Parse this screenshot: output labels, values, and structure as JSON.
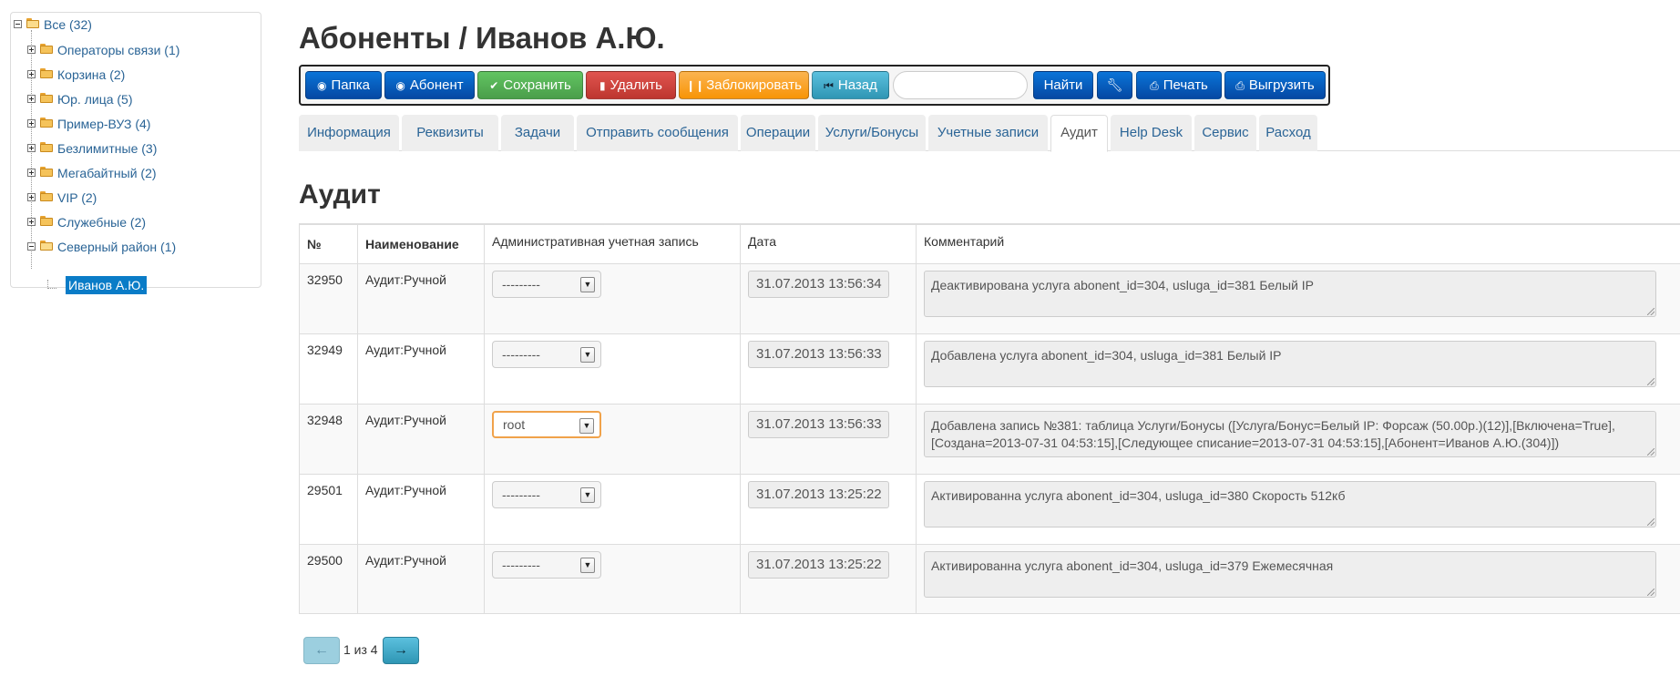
{
  "tree": {
    "root": {
      "label": "Все (32)"
    },
    "items": [
      {
        "label": "Операторы связи (1)"
      },
      {
        "label": "Корзина (2)"
      },
      {
        "label": "Юр. лица (5)"
      },
      {
        "label": "Пример-ВУЗ (4)"
      },
      {
        "label": "Безлимитные (3)"
      },
      {
        "label": "Мегабайтный (2)"
      },
      {
        "label": "VIP (2)"
      },
      {
        "label": "Служебные (2)"
      },
      {
        "label": "Северный район (1)"
      }
    ],
    "selected": "Иванов А.Ю."
  },
  "header": {
    "title": "Абоненты / Иванов А.Ю."
  },
  "toolbar": {
    "folder": "Папка",
    "subscriber": "Абонент",
    "save": "Сохранить",
    "delete": "Удалить",
    "block": "Заблокировать",
    "back": "Назад",
    "search_value": "",
    "find": "Найти",
    "print": "Печать",
    "export": "Выгрузить"
  },
  "tabs": [
    {
      "label": "Информация"
    },
    {
      "label": "Реквизиты"
    },
    {
      "label": "Задачи"
    },
    {
      "label": "Отправить сообщения"
    },
    {
      "label": "Операции"
    },
    {
      "label": "Услуги/Бонусы"
    },
    {
      "label": "Учетные записи"
    },
    {
      "label": "Аудит",
      "active": true
    },
    {
      "label": "Help Desk"
    },
    {
      "label": "Сервис"
    },
    {
      "label": "Расход"
    }
  ],
  "section": {
    "title": "Аудит"
  },
  "table": {
    "headers": {
      "num": "№",
      "name": "Наименование",
      "admin": "Административная учетная запись",
      "date": "Дата",
      "comment": "Комментарий"
    },
    "rows": [
      {
        "num": "32950",
        "name": "Аудит:Ручной",
        "admin": "---------",
        "date": "31.07.2013 13:56:34",
        "comment": "Деактивирована услуга abonent_id=304, usluga_id=381 Белый IP"
      },
      {
        "num": "32949",
        "name": "Аудит:Ручной",
        "admin": "---------",
        "date": "31.07.2013 13:56:33",
        "comment": "Добавлена услуга abonent_id=304, usluga_id=381 Белый IP"
      },
      {
        "num": "32948",
        "name": "Аудит:Ручной",
        "admin": "root",
        "date": "31.07.2013 13:56:33",
        "comment": "Добавлена запись №381: таблица Услуги/Бонусы ([Услуга/Бонус=Белый IP: Форсаж (50.00р.)(12)],[Включена=True],[Создана=2013-07-31 04:53:15],[Следующее списание=2013-07-31 04:53:15],[Абонент=Иванов А.Ю.(304)])"
      },
      {
        "num": "29501",
        "name": "Аудит:Ручной",
        "admin": "---------",
        "date": "31.07.2013 13:25:22",
        "comment": "Активированна услуга abonent_id=304, usluga_id=380 Скорость 512кб"
      },
      {
        "num": "29500",
        "name": "Аудит:Ручной",
        "admin": "---------",
        "date": "31.07.2013 13:25:22",
        "comment": "Активированна услуга abonent_id=304, usluga_id=379 Ежемесячная"
      }
    ]
  },
  "pager": {
    "text": "1 из 4",
    "prev": "←",
    "next": "→"
  },
  "colors": {
    "accent": "#0548a3",
    "selected": "#0a7cc7",
    "link": "#2a6496"
  }
}
